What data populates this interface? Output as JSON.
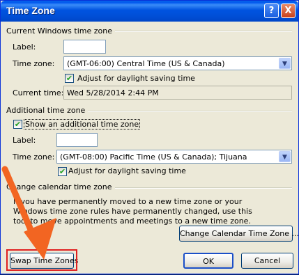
{
  "window": {
    "title": "Time Zone",
    "help_label": "?",
    "close_label": "X"
  },
  "current": {
    "section_title": "Current Windows time zone",
    "label_label": "Label:",
    "label_value": "",
    "timezone_label": "Time zone:",
    "timezone_value": "(GMT-06:00) Central Time (US & Canada)",
    "dst_checked": true,
    "dst_label": "Adjust for daylight saving time",
    "current_time_label": "Current time:",
    "current_time_value": "Wed 5/28/2014 2:44 PM"
  },
  "additional": {
    "section_title": "Additional time zone",
    "show_checked": true,
    "show_label": "Show an additional time zone",
    "label_label": "Label:",
    "label_value": "",
    "timezone_label": "Time zone:",
    "timezone_value": "(GMT-08:00) Pacific Time (US & Canada); Tijuana",
    "dst_checked": true,
    "dst_label": "Adjust for daylight saving time"
  },
  "change": {
    "section_title": "Change calendar time zone",
    "description": "If you have permanently moved to a new time zone or your Windows time zone rules have permanently changed, use this tool to move appointments and meetings to a new time zone.",
    "button_label": "Change Calendar Time Zone ..."
  },
  "footer": {
    "swap_label": "Swap Time Zones",
    "ok_label": "OK",
    "cancel_label": "Cancel"
  },
  "annotation": {
    "highlight_color": "#e02020",
    "arrow_color": "#f26522"
  }
}
